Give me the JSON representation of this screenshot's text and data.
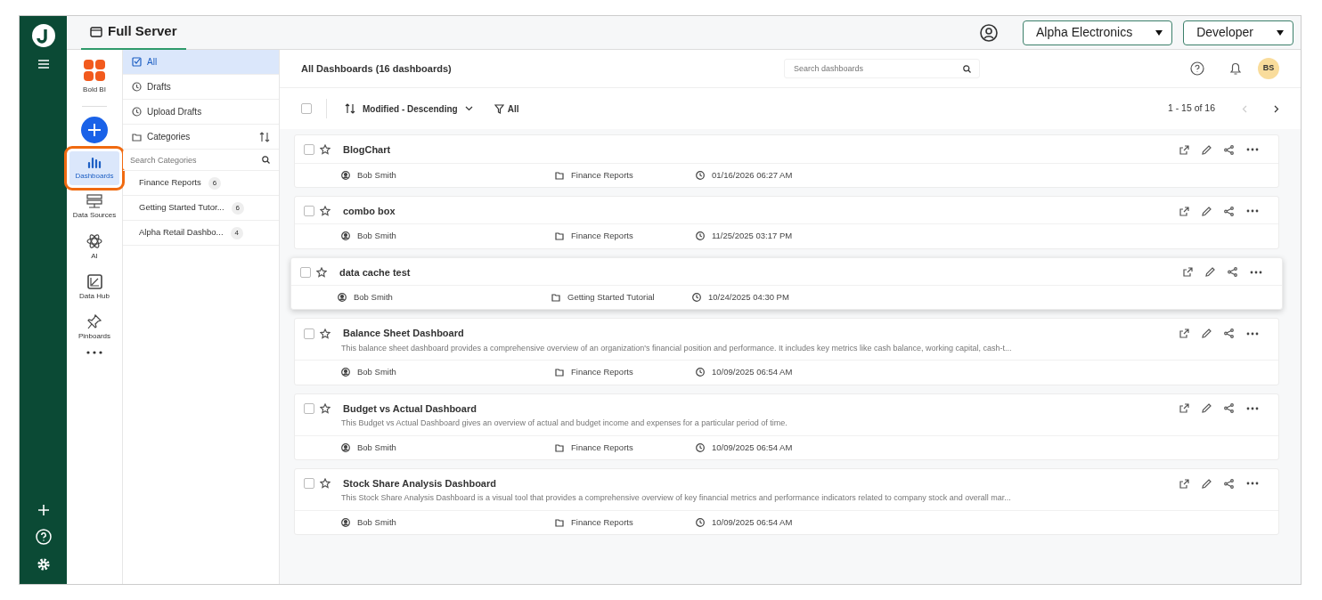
{
  "header": {
    "tab": {
      "label": "Full Server",
      "selected": true
    },
    "tenant": "Alpha Electronics",
    "role": "Developer"
  },
  "product": {
    "name": "Bold BI"
  },
  "nav": [
    {
      "label": "Dashboards",
      "selected": true,
      "highlighted": true
    },
    {
      "label": "Data Sources",
      "selected": false,
      "highlighted": false
    },
    {
      "label": "AI",
      "selected": false,
      "highlighted": false
    },
    {
      "label": "Data Hub",
      "selected": false,
      "highlighted": false
    },
    {
      "label": "Pinboards",
      "selected": false,
      "highlighted": false
    }
  ],
  "filters": [
    {
      "label": "All",
      "selected": true
    },
    {
      "label": "Drafts",
      "selected": false
    },
    {
      "label": "Upload Drafts",
      "selected": false
    }
  ],
  "categories": {
    "label": "Categories",
    "search_placeholder": "Search Categories",
    "items": [
      {
        "name": "Finance Reports",
        "count": "6"
      },
      {
        "name": "Getting Started Tutor...",
        "count": "6"
      },
      {
        "name": "Alpha Retail Dashbo...",
        "count": "4"
      }
    ]
  },
  "main": {
    "title": "All Dashboards (16 dashboards)",
    "search_placeholder": "Search dashboards",
    "avatar": "BS",
    "select_all_checked": false,
    "sort": "Modified - Descending",
    "filter": "All",
    "paging": "1 - 15 of 16"
  },
  "dashboards": [
    {
      "name": "BlogChart",
      "owner": "Bob Smith",
      "category": "Finance Reports",
      "modified": "01/16/2026 06:27 AM",
      "hovered": false,
      "checked": false
    },
    {
      "name": "combo box",
      "owner": "Bob Smith",
      "category": "Finance Reports",
      "modified": "11/25/2025 03:17 PM",
      "hovered": false,
      "checked": false
    },
    {
      "name": "data cache test",
      "owner": "Bob Smith",
      "category": "Getting Started Tutorial",
      "modified": "10/24/2025 04:30 PM",
      "hovered": true,
      "checked": false
    },
    {
      "checked": false,
      "name": "Balance Sheet Dashboard",
      "description": "This balance sheet dashboard provides a comprehensive overview of an organization's financial position and performance. It includes key metrics like cash balance, working capital, cash-t...",
      "owner": "Bob Smith",
      "category": "Finance Reports",
      "modified": "10/09/2025 06:54 AM",
      "hovered": false
    },
    {
      "checked": false,
      "name": "Budget vs Actual Dashboard",
      "description": "This Budget vs Actual Dashboard gives an overview of actual and budget income and expenses for a particular period of time.",
      "owner": "Bob Smith",
      "category": "Finance Reports",
      "modified": "10/09/2025 06:54 AM",
      "hovered": false
    },
    {
      "checked": false,
      "name": "Stock Share Analysis Dashboard",
      "description": "This Stock Share Analysis Dashboard is a visual tool that provides a comprehensive overview of key financial metrics and performance indicators related to company stock and overall mar...",
      "owner": "Bob Smith",
      "category": "Finance Reports",
      "modified": "10/09/2025 06:54 AM",
      "hovered": false
    }
  ]
}
